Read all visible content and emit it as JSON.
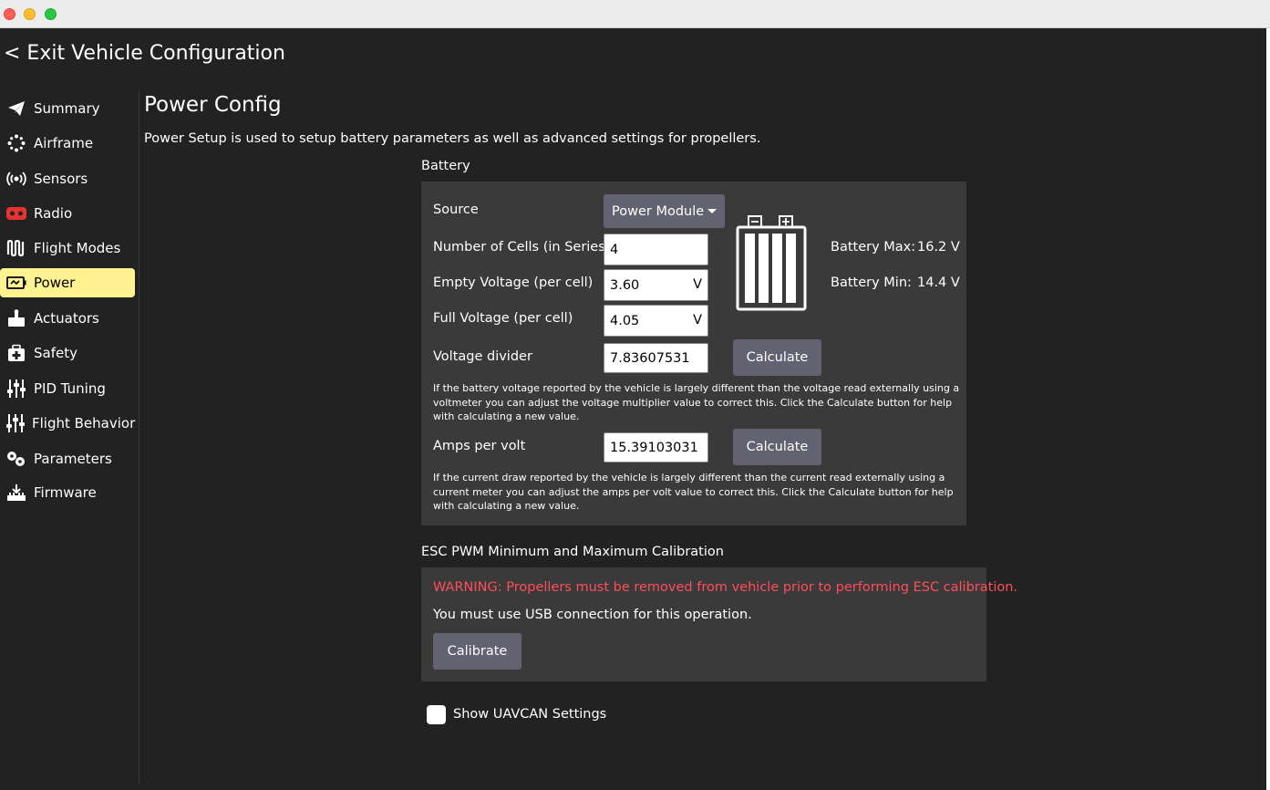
{
  "exit": {
    "label": "< Exit Vehicle Configuration"
  },
  "sidebar": {
    "items": [
      {
        "label": "Summary",
        "icon": "paper-plane-icon"
      },
      {
        "label": "Airframe",
        "icon": "airframe-icon"
      },
      {
        "label": "Sensors",
        "icon": "sensors-icon"
      },
      {
        "label": "Radio",
        "icon": "radio-icon"
      },
      {
        "label": "Flight Modes",
        "icon": "flight-modes-icon"
      },
      {
        "label": "Power",
        "icon": "power-icon",
        "active": true
      },
      {
        "label": "Actuators",
        "icon": "actuators-icon"
      },
      {
        "label": "Safety",
        "icon": "safety-icon"
      },
      {
        "label": "PID Tuning",
        "icon": "sliders-icon"
      },
      {
        "label": "Flight Behavior",
        "icon": "sliders-icon"
      },
      {
        "label": "Parameters",
        "icon": "parameters-icon"
      },
      {
        "label": "Firmware",
        "icon": "firmware-icon"
      }
    ]
  },
  "page": {
    "title": "Power Config",
    "description": "Power Setup is used to setup battery parameters as well as advanced settings for propellers."
  },
  "battery": {
    "section_label": "Battery",
    "source_label": "Source",
    "source_value": "Power Module",
    "cells_label": "Number of Cells (in Series)",
    "cells_value": "4",
    "empty_label": "Empty Voltage (per cell)",
    "empty_value": "3.60",
    "full_label": "Full Voltage (per cell)",
    "full_value": "4.05",
    "volt_unit": "V",
    "max_label": "Battery Max:",
    "max_value": "16.2 V",
    "min_label": "Battery Min:",
    "min_value": "14.4 V",
    "divider_label": "Voltage divider",
    "divider_value": "7.83607531",
    "calculate_label": "Calculate",
    "divider_help": "If the battery voltage reported by the vehicle is largely different than the voltage read externally using a voltmeter you can adjust the voltage multiplier value to correct this. Click the Calculate button for help with calculating a new value.",
    "amps_label": "Amps per volt",
    "amps_value": "15.39103031",
    "amps_help": "If the current draw reported by the vehicle is largely different than the current read externally using a current meter you can adjust the amps per volt value to correct this. Click the Calculate button for help with calculating a new value."
  },
  "esc": {
    "section_label": "ESC PWM Minimum and Maximum Calibration",
    "warning": "WARNING: Propellers must be removed from vehicle prior to performing ESC calibration.",
    "usb_note": "You must use USB connection for this operation.",
    "calibrate_label": "Calibrate"
  },
  "uavcan": {
    "label": "Show UAVCAN Settings",
    "checked": false
  },
  "colors": {
    "accent": "#fff291",
    "warning": "#ff4d5a",
    "panel": "#3a3a3a",
    "button": "#626270"
  }
}
